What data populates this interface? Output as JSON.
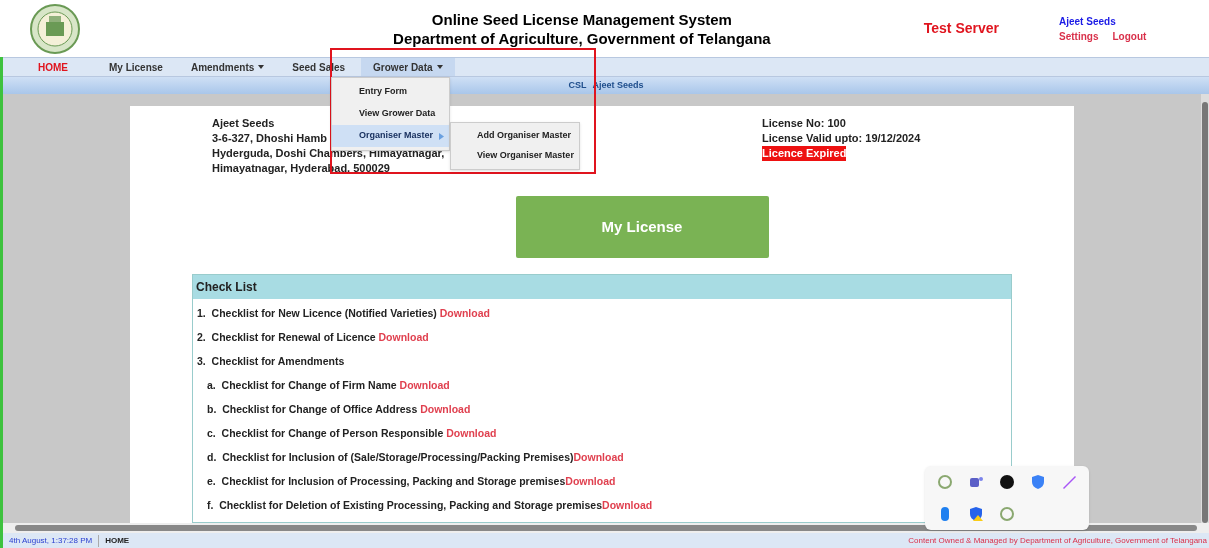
{
  "header": {
    "title_lines": [
      "Online Seed License Management System",
      "Department of Agriculture, Government of Telangana"
    ],
    "server_label": "Test Server",
    "user": "Ajeet Seeds",
    "links": [
      "Settings",
      "Logout"
    ]
  },
  "nav": [
    {
      "label": "HOME",
      "selected": true,
      "has_menu": false
    },
    {
      "label": "My License",
      "selected": false,
      "has_menu": false
    },
    {
      "label": "Amendments",
      "selected": false,
      "has_menu": true
    },
    {
      "label": "Seed Sales",
      "selected": false,
      "has_menu": false
    },
    {
      "label": "Grower Data",
      "selected": false,
      "has_menu": true,
      "open": true
    }
  ],
  "dropdown": [
    {
      "label": "Entry Form",
      "selected": false
    },
    {
      "label": "View Grower Data",
      "selected": false
    },
    {
      "label": "Organiser Master",
      "selected": true,
      "submenu": [
        "Add Organiser Master",
        "View Organiser Master"
      ]
    }
  ],
  "breadcrumb": {
    "prefix": "CSL",
    "name": "Ajeet Seeds"
  },
  "firm": {
    "name": "Ajeet Seeds",
    "address_lines": [
      "3-6-327, Dhoshi Hamb",
      "Hyderguda, Doshi Chambers, Himayatnagar,",
      "Himayatnagar, Hyderabad, 500029"
    ]
  },
  "license": {
    "number": "License No: 100",
    "valid": "License Valid upto: 19/12/2024",
    "status": "Licence Expired",
    "expired": true
  },
  "main_button": "My License",
  "checklist": {
    "title": "Check List",
    "items": [
      {
        "marker": "1.",
        "text": "Checklist for New Licence (Notified Varieties) ",
        "link": "Download",
        "sub": false
      },
      {
        "marker": "2.",
        "text": "Checklist for Renewal of Licence ",
        "link": "Download",
        "sub": false
      },
      {
        "marker": "3.",
        "text": "Checklist for Amendments",
        "sub": false
      },
      {
        "marker": "a.",
        "text": "Checklist for Change of Firm Name ",
        "link": "Download",
        "sub": true
      },
      {
        "marker": "b.",
        "text": "Checklist for Change of Office Address ",
        "link": "Download",
        "sub": true
      },
      {
        "marker": "c.",
        "text": "Checklist for Change of Person Responsible ",
        "link": "Download",
        "sub": true
      },
      {
        "marker": "d.",
        "text": "Checklist for Inclusion of (Sale/Storage/Processing/Packing Premises)",
        "link": "Download",
        "sub": true
      },
      {
        "marker": "e.",
        "text": "Checklist for Inclusion of Processing, Packing and Storage premises",
        "link": "Download",
        "sub": true
      },
      {
        "marker": "f.",
        "text": "Checklist for Deletion of Existing Processing, Packing and Storage premises",
        "link": "Download",
        "sub": true
      }
    ]
  },
  "status_bar": {
    "datetime": "4th August, 1:37:28 PM",
    "page": "HOME",
    "footer": "Content Owned & Managed by Department of Agriculture, Government of Telangana"
  },
  "tray": [
    {
      "kind": "browser"
    },
    {
      "kind": "teams"
    },
    {
      "kind": "grammar"
    },
    {
      "kind": "shield"
    },
    {
      "kind": "pen"
    },
    {
      "kind": "bluetooth"
    },
    {
      "kind": "security"
    },
    {
      "kind": "browser"
    }
  ]
}
